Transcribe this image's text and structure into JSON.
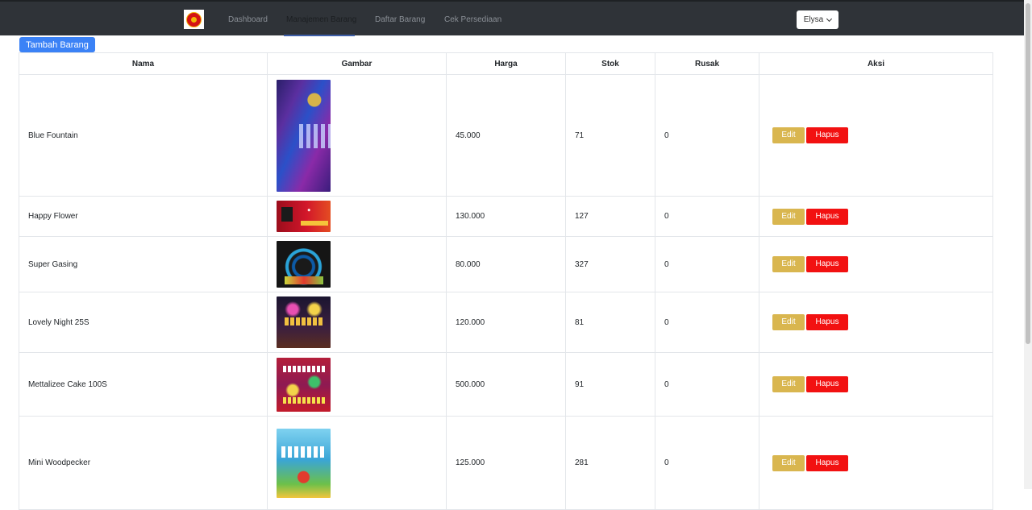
{
  "nav": {
    "links": [
      "Dashboard",
      "Manajemen Barang",
      "Daftar Barang",
      "Cek Persediaan"
    ],
    "active": "Manajemen Barang",
    "user": "Elysa"
  },
  "actions": {
    "add_button": "Tambah Barang",
    "edit": "Edit",
    "delete": "Hapus"
  },
  "table": {
    "headers": [
      "Nama",
      "Gambar",
      "Harga",
      "Stok",
      "Rusak",
      "Aksi"
    ],
    "rows": [
      {
        "nama": "Blue Fountain",
        "harga": "45.000",
        "stok": "71",
        "rusak": "0"
      },
      {
        "nama": "Happy Flower",
        "harga": "130.000",
        "stok": "127",
        "rusak": "0"
      },
      {
        "nama": "Super Gasing",
        "harga": "80.000",
        "stok": "327",
        "rusak": "0"
      },
      {
        "nama": "Lovely Night 25S",
        "harga": "120.000",
        "stok": "81",
        "rusak": "0"
      },
      {
        "nama": "Mettalizee Cake 100S",
        "harga": "500.000",
        "stok": "91",
        "rusak": "0"
      },
      {
        "nama": "Mini Woodpecker",
        "harga": "125.000",
        "stok": "281",
        "rusak": "0"
      }
    ]
  },
  "colors": {
    "navbar": "#2f3338",
    "primary": "#3b82f6",
    "edit": "#d9b64f",
    "delete": "#f21111"
  }
}
